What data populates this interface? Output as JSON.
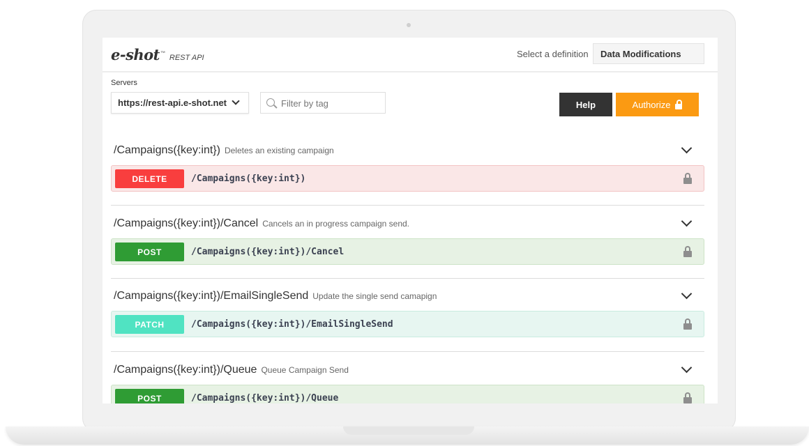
{
  "header": {
    "logo_text": "e-shot",
    "logo_tm": "™",
    "logo_sub": "REST API",
    "definition_label": "Select a definition",
    "definition_value": "Data Modifications"
  },
  "controls": {
    "servers_label": "Servers",
    "server_value": "https://rest-api.e-shot.net",
    "filter_placeholder": "Filter by tag",
    "help_label": "Help",
    "authorize_label": "Authorize"
  },
  "colors": {
    "delete": "#f93e3e",
    "post": "#2f9c34",
    "patch": "#50e3c2",
    "authorize": "#fb9a12",
    "help": "#333333"
  },
  "tags": [
    {
      "name": "/Campaigns({key:int})",
      "description": "Deletes an existing campaign",
      "method": "DELETE",
      "path": "/Campaigns({key:int})"
    },
    {
      "name": "/Campaigns({key:int})/Cancel",
      "description": "Cancels an in progress campaign send.",
      "method": "POST",
      "path": "/Campaigns({key:int})/Cancel"
    },
    {
      "name": "/Campaigns({key:int})/EmailSingleSend",
      "description": "Update the single send camapign",
      "method": "PATCH",
      "path": "/Campaigns({key:int})/EmailSingleSend"
    },
    {
      "name": "/Campaigns({key:int})/Queue",
      "description": "Queue Campaign Send",
      "method": "POST",
      "path": "/Campaigns({key:int})/Queue"
    }
  ]
}
